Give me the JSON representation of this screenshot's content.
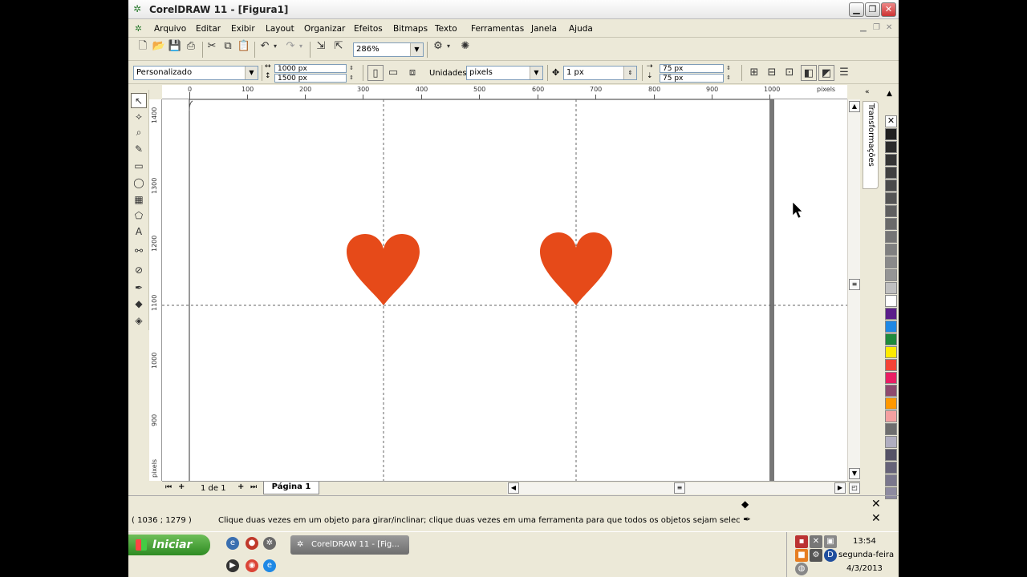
{
  "window": {
    "title": "CorelDRAW 11 - [Figura1]"
  },
  "menu": [
    "Arquivo",
    "Editar",
    "Exibir",
    "Layout",
    "Organizar",
    "Efeitos",
    "Bitmaps",
    "Texto",
    "Ferramentas",
    "Janela",
    "Ajuda"
  ],
  "standard_toolbar": {
    "zoom": "286%"
  },
  "property_bar": {
    "paper": "Personalizado",
    "width": "1000 px",
    "height": "1500 px",
    "units_label": "Unidades:",
    "units": "pixels",
    "nudge": "1 px",
    "dup_x": "75 px",
    "dup_y": "75 px"
  },
  "ruler": {
    "h_ticks": [
      "0",
      "100",
      "200",
      "300",
      "400",
      "500",
      "600",
      "700",
      "800",
      "900",
      "1000"
    ],
    "h_unit": "pixels",
    "v_ticks": [
      "1400",
      "1300",
      "1200",
      "1100",
      "1000",
      "900"
    ],
    "v_unit": "pixels"
  },
  "shapes": [
    {
      "name": "heart",
      "color": "#e64a19"
    },
    {
      "name": "heart",
      "color": "#e64a19"
    }
  ],
  "page_nav": {
    "count": "1 de 1",
    "tab": "Página 1"
  },
  "docker": {
    "label": "Transformações"
  },
  "palette": [
    "#ffffff",
    "#202020",
    "#2b2b2b",
    "#353535",
    "#404040",
    "#4a4a4a",
    "#555555",
    "#606060",
    "#6a6a6a",
    "#757575",
    "#808080",
    "#8a8a8a",
    "#959595",
    "#c0c0c0",
    "#ffffff",
    "#5b1e8a",
    "#1e88e5",
    "#1e8a3c",
    "#ffeb00",
    "#f44336",
    "#e91e63",
    "#8e4a6e",
    "#ff9800",
    "#f4a0a0",
    "#6e6e6e",
    "#b0aec0",
    "#555266",
    "#666378",
    "#7a778c",
    "#8e8ba0"
  ],
  "status": {
    "coords": "( 1036 ; 1279 )",
    "hint": "Clique duas vezes em um objeto para girar/inclinar; clique duas vezes em uma ferramenta para que todos os objetos sejam selecionados, clique c..."
  },
  "taskbar": {
    "start": "Iniciar",
    "task": "CorelDRAW 11 - [Fig...",
    "time": "13:54",
    "day": "segunda-feira",
    "date": "4/3/2013"
  }
}
